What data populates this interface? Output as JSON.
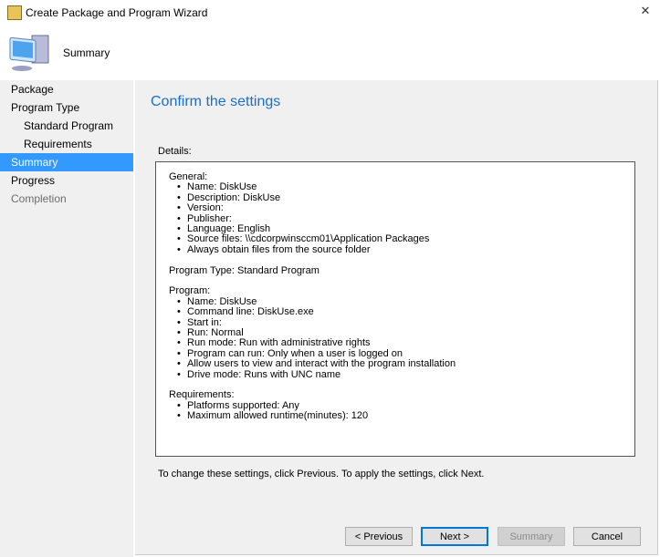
{
  "window": {
    "title": "Create Package and Program Wizard",
    "close": "✕"
  },
  "header": {
    "title": "Summary"
  },
  "nav": {
    "items": [
      {
        "label": "Package",
        "level": 0,
        "state": "normal"
      },
      {
        "label": "Program Type",
        "level": 0,
        "state": "normal"
      },
      {
        "label": "Standard Program",
        "level": 1,
        "state": "normal"
      },
      {
        "label": "Requirements",
        "level": 1,
        "state": "normal"
      },
      {
        "label": "Summary",
        "level": 0,
        "state": "selected"
      },
      {
        "label": "Progress",
        "level": 0,
        "state": "normal"
      },
      {
        "label": "Completion",
        "level": 0,
        "state": "disabled"
      }
    ]
  },
  "main": {
    "title": "Confirm the settings",
    "details_label": "Details:",
    "general": {
      "heading": "General:",
      "items": [
        "Name: DiskUse",
        "Description: DiskUse",
        "Version:",
        "Publisher:",
        "Language: English",
        "Source files: \\\\cdcorpwinsccm01\\Application Packages",
        "Always obtain files from the source folder"
      ]
    },
    "program_type": "Program Type: Standard Program",
    "program": {
      "heading": "Program:",
      "items": [
        "Name: DiskUse",
        "Command line: DiskUse.exe",
        "Start in:",
        "Run: Normal",
        "Run mode: Run with administrative rights",
        "Program can run: Only when a user is logged on",
        "Allow users to view and interact with the program installation",
        "Drive mode: Runs with UNC name"
      ]
    },
    "requirements": {
      "heading": "Requirements:",
      "items": [
        "Platforms supported: Any",
        "Maximum allowed runtime(minutes): 120"
      ]
    },
    "hint": "To change these settings, click Previous. To apply the settings, click Next."
  },
  "buttons": {
    "previous": "< Previous",
    "next": "Next >",
    "summary": "Summary",
    "cancel": "Cancel"
  },
  "colors": {
    "accent": "#3399ff",
    "title": "#1a6fc9"
  }
}
